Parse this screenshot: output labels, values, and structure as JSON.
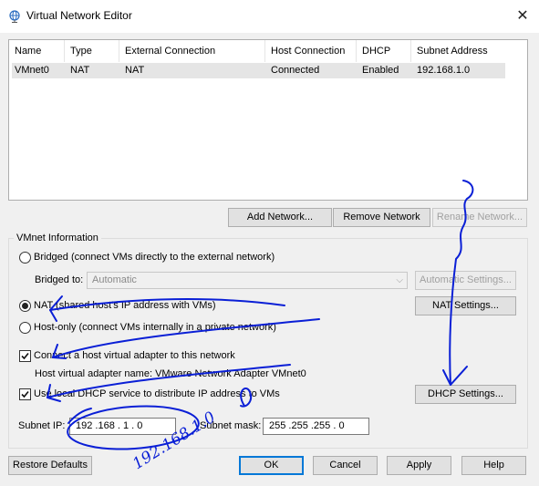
{
  "window": {
    "title": "Virtual Network Editor",
    "close_glyph": "✕",
    "icon": "globe-network-icon"
  },
  "table": {
    "headers": [
      "Name",
      "Type",
      "External Connection",
      "Host Connection",
      "DHCP",
      "Subnet Address"
    ],
    "rows": [
      [
        "VMnet0",
        "NAT",
        "NAT",
        "Connected",
        "Enabled",
        "192.168.1.0"
      ]
    ]
  },
  "table_buttons": {
    "add": "Add Network...",
    "remove": "Remove Network",
    "rename": "Rename Network..."
  },
  "vmnet_info": {
    "group_label": "VMnet Information",
    "bridged_label": "Bridged (connect VMs directly to the external network)",
    "bridged_to_label": "Bridged to:",
    "bridged_to_value": "Automatic",
    "automatic_settings": "Automatic Settings...",
    "nat_label": "NAT (shared host's IP address with VMs)",
    "nat_settings": "NAT Settings...",
    "hostonly_label": "Host-only (connect VMs internally in a private network)",
    "connect_adapter_label": "Connect a host virtual adapter to this network",
    "adapter_name_label": "Host virtual adapter name: VMware Network Adapter VMnet0",
    "dhcp_label": "Use local DHCP service to distribute IP address to VMs",
    "dhcp_settings": "DHCP Settings...",
    "selected_mode": "NAT",
    "connect_adapter_checked": true,
    "dhcp_checked": true
  },
  "subnet": {
    "ip_label": "Subnet IP:",
    "ip_value": "192 .168 . 1 . 0",
    "mask_label": "Subnet mask:",
    "mask_value": "255 .255 .255 . 0"
  },
  "footer": {
    "restore": "Restore Defaults",
    "ok": "OK",
    "cancel": "Cancel",
    "apply": "Apply",
    "help": "Help"
  },
  "handwriting": {
    "ip_scribble": "192.168.1.0",
    "color": "#0a1fd6"
  },
  "colors": {
    "focus_border": "#0078d7",
    "selected_row": "#e5e5e5"
  }
}
